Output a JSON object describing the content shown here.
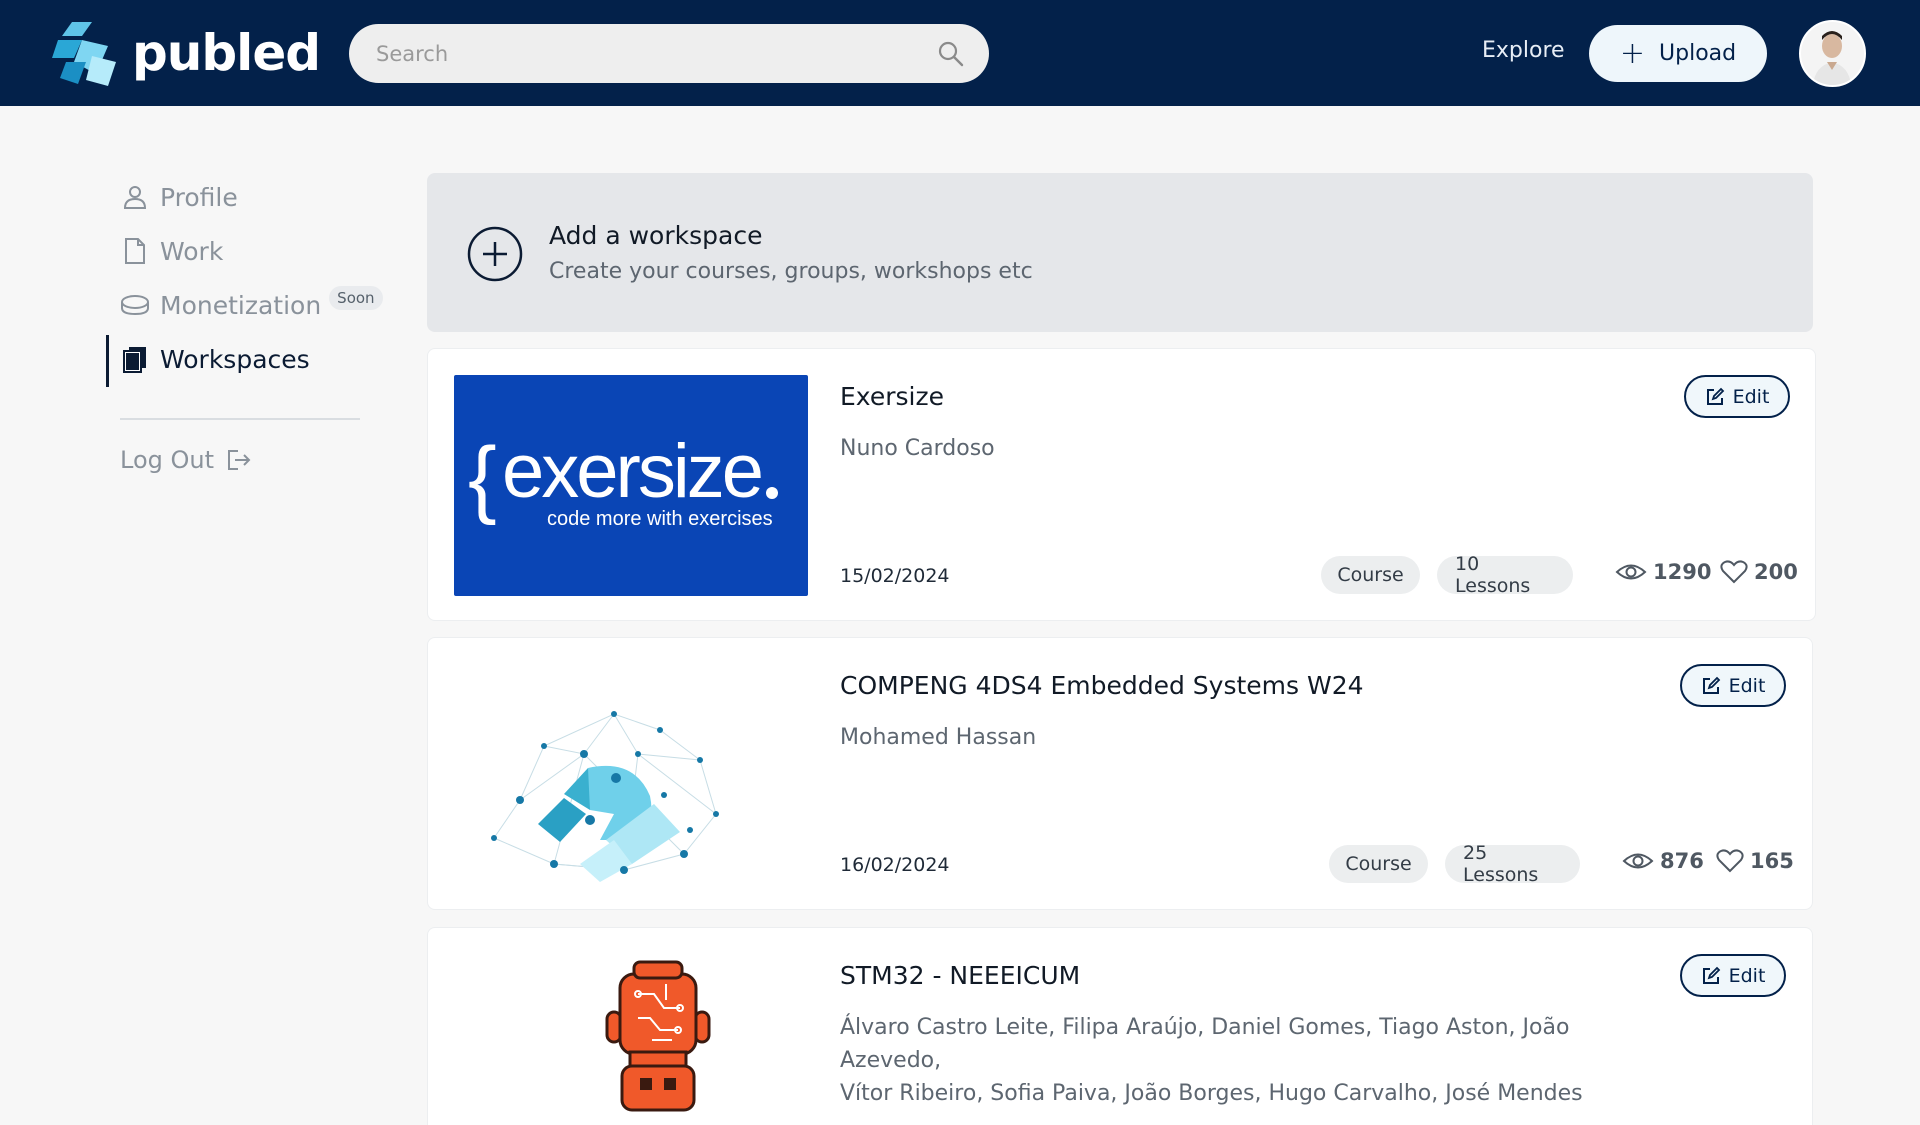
{
  "header": {
    "brand": "publed",
    "search_placeholder": "Search",
    "explore_label": "Explore",
    "upload_label": "Upload"
  },
  "sidebar": {
    "items": [
      {
        "label": "Profile",
        "icon": "user-icon"
      },
      {
        "label": "Work",
        "icon": "document-icon"
      },
      {
        "label": "Monetization",
        "icon": "coins-icon",
        "badge": "Soon"
      },
      {
        "label": "Workspaces",
        "icon": "workspaces-icon",
        "active": true
      }
    ],
    "logout_label": "Log Out"
  },
  "add_workspace": {
    "title": "Add a workspace",
    "subtitle": "Create your courses, groups, workshops etc"
  },
  "workspaces": [
    {
      "title": "Exersize",
      "author": "Nuno Cardoso",
      "date": "15/02/2024",
      "type": "Course",
      "lessons": "10 Lessons",
      "views": "1290",
      "likes": "200",
      "edit_label": "Edit",
      "thumb_text": "exersize",
      "thumb_tagline": "code more with exercises"
    },
    {
      "title": "COMPENG 4DS4 Embedded Systems W24",
      "author": "Mohamed Hassan",
      "date": "16/02/2024",
      "type": "Course",
      "lessons": "25 Lessons",
      "views": "876",
      "likes": "165",
      "edit_label": "Edit"
    },
    {
      "title": "STM32 - NEEEICUM",
      "author_line1": "Álvaro Castro Leite, Filipa Araújo, Daniel Gomes, Tiago Aston, João Azevedo,",
      "author_line2": "Vítor Ribeiro, Sofia Paiva, João Borges, Hugo Carvalho, José Mendes",
      "edit_label": "Edit"
    }
  ],
  "colors": {
    "header_bg": "#03214a",
    "accent": "#03214a",
    "exersize_blue": "#0a45b5",
    "robot_orange": "#f0592a"
  }
}
